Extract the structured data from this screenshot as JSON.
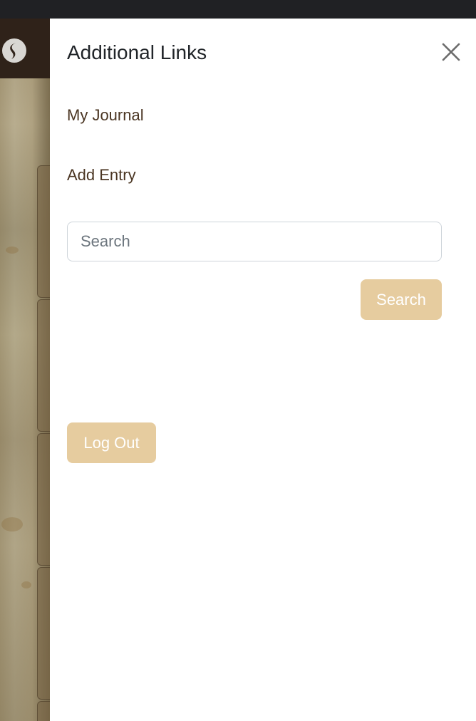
{
  "panel": {
    "title": "Additional Links",
    "close_label": "×"
  },
  "links": [
    {
      "label": "My Journal"
    },
    {
      "label": "Add Entry"
    }
  ],
  "search": {
    "placeholder": "Search",
    "value": "",
    "button_label": "Search"
  },
  "logout": {
    "label": "Log Out"
  },
  "colors": {
    "accent": "#e6cc9f",
    "navbar": "#2f2219",
    "topbar": "#202124",
    "link": "#4a3522"
  },
  "icons": {
    "brand": "brand-logo-icon",
    "close": "close-icon"
  }
}
